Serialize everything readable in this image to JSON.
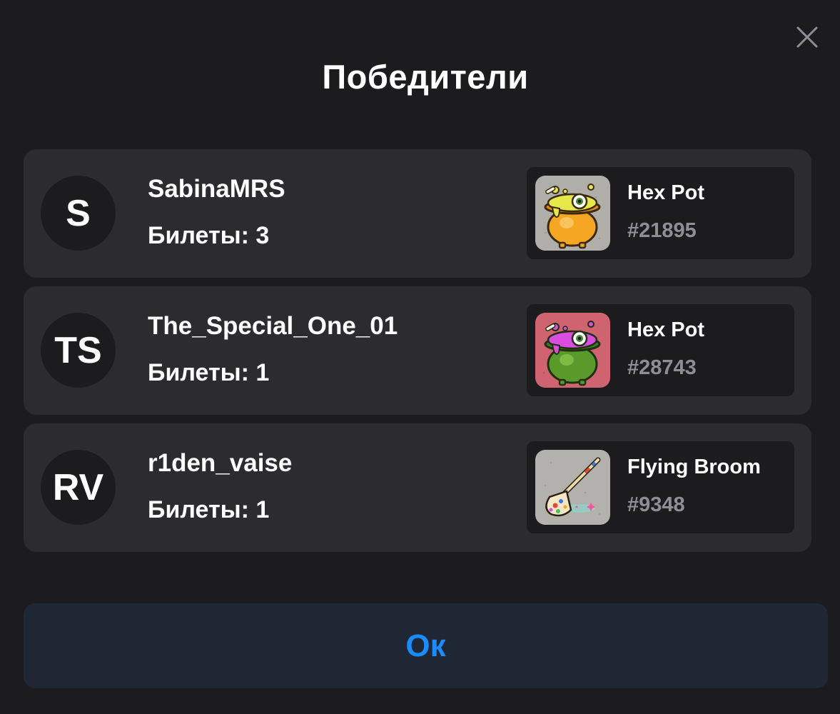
{
  "dialog": {
    "title": "Победители",
    "close_icon": "close-icon",
    "ok_label": "Ок"
  },
  "colors": {
    "background": "#1c1c1e",
    "card": "#2c2c2e",
    "accent": "#1a8cff",
    "muted_text": "#8e8e93",
    "ok_button_bg": "#1e2733"
  },
  "winners": [
    {
      "initials": "S",
      "username": "SabinaMRS",
      "tickets": "Билеты: 3",
      "prize": {
        "name": "Hex Pot",
        "number": "#21895",
        "icon": "hex-pot-gold-icon",
        "bg_color": "#b0aea8"
      }
    },
    {
      "initials": "TS",
      "username": "The_Special_One_01",
      "tickets": "Билеты: 1",
      "prize": {
        "name": "Hex Pot",
        "number": "#28743",
        "icon": "hex-pot-green-icon",
        "bg_color": "#cf6470"
      }
    },
    {
      "initials": "RV",
      "username": "r1den_vaise",
      "tickets": "Билеты: 1",
      "prize": {
        "name": "Flying Broom",
        "number": "#9348",
        "icon": "flying-broom-icon",
        "bg_color": "#b3b1ac"
      }
    }
  ]
}
